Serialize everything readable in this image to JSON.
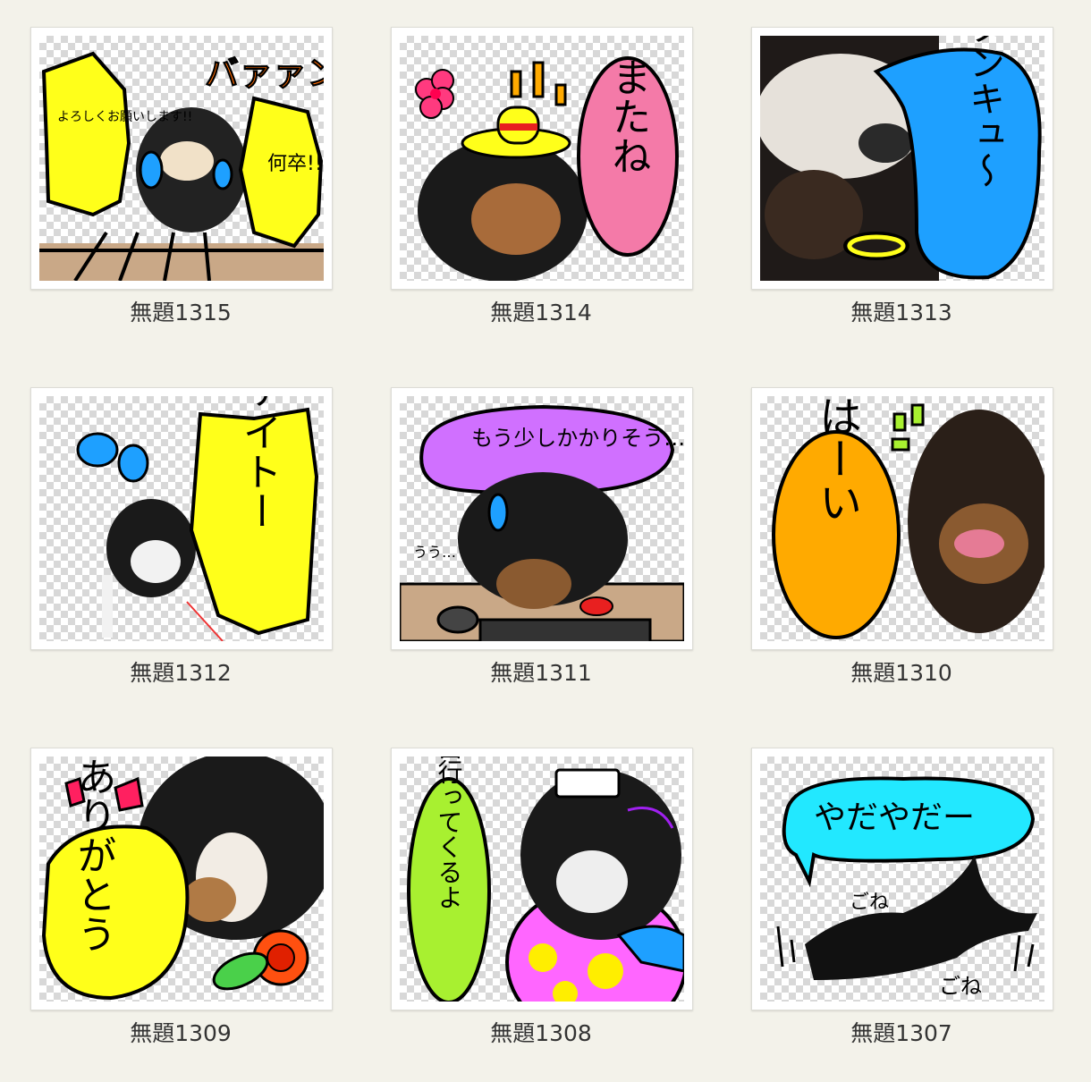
{
  "items": [
    {
      "title": "無題1315",
      "text_main": "バァァン",
      "text_left": "よろしくお願いします!!",
      "text_right": "何卒!!"
    },
    {
      "title": "無題1314",
      "text_main": "またね"
    },
    {
      "title": "無題1313",
      "text_main": "バタンキュ〜"
    },
    {
      "title": "無題1312",
      "text_main": "ファイトー"
    },
    {
      "title": "無題1311",
      "text_main": "もう少しかかりそう…",
      "text_sub": "うう…"
    },
    {
      "title": "無題1310",
      "text_main": "はーい"
    },
    {
      "title": "無題1309",
      "text_main": "ありがとう"
    },
    {
      "title": "無題1308",
      "text_main": "お風呂行ってくるよ"
    },
    {
      "title": "無題1307",
      "text_main": "やだやだー",
      "text_sub1": "ごね",
      "text_sub2": "ごね"
    }
  ],
  "colors": {
    "background": "#f3f2ea",
    "yellow": "#ffff1a",
    "pink": "#f47aa8",
    "blue": "#1ea0ff",
    "purple": "#d070ff",
    "orange": "#ffaa00",
    "green": "#a8f030",
    "cyan": "#22e8ff",
    "magenta": "#ff66ff"
  }
}
